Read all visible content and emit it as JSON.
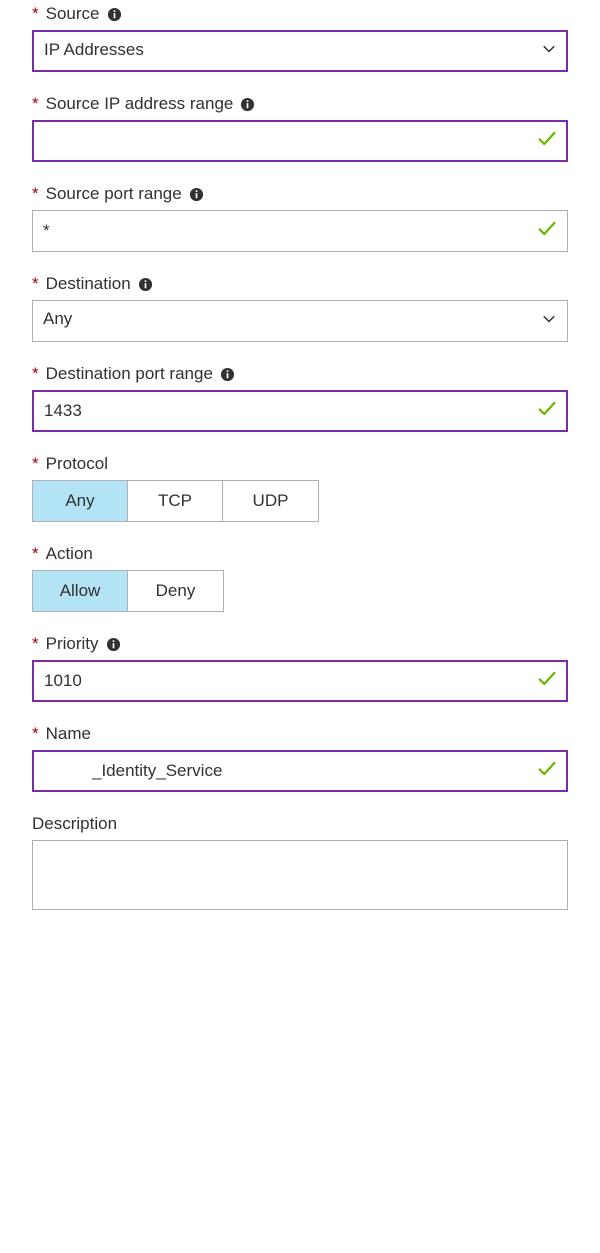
{
  "source": {
    "label": "Source",
    "value": "IP Addresses"
  },
  "sourceIpRange": {
    "label": "Source IP address range",
    "value": ""
  },
  "sourcePortRange": {
    "label": "Source port range",
    "value": "*"
  },
  "destination": {
    "label": "Destination",
    "value": "Any"
  },
  "destinationPortRange": {
    "label": "Destination port range",
    "value": "1433"
  },
  "protocol": {
    "label": "Protocol",
    "options": {
      "any": "Any",
      "tcp": "TCP",
      "udp": "UDP"
    },
    "selected": "any"
  },
  "action": {
    "label": "Action",
    "options": {
      "allow": "Allow",
      "deny": "Deny"
    },
    "selected": "allow"
  },
  "priority": {
    "label": "Priority",
    "value": "1010"
  },
  "name": {
    "label": "Name",
    "value": "_Identity_Service"
  },
  "description": {
    "label": "Description",
    "value": ""
  }
}
